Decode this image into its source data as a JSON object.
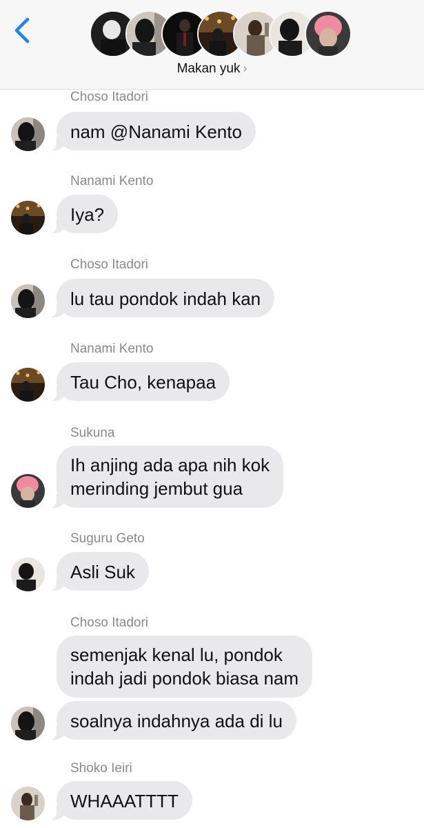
{
  "header": {
    "group_name": "Makan yuk",
    "chevron": "›",
    "back_icon": "chevron-left-icon",
    "accent_color": "#1a82fb"
  },
  "messages": [
    {
      "sender": "Choso Itadori",
      "lines": [
        "nam @Nanami Kento"
      ]
    },
    {
      "sender": "Nanami Kento",
      "lines": [
        "Iya?"
      ]
    },
    {
      "sender": "Choso Itadori",
      "lines": [
        "lu tau pondok indah kan"
      ]
    },
    {
      "sender": "Nanami Kento",
      "lines": [
        "Tau Cho, kenapaa"
      ]
    },
    {
      "sender": "Sukuna",
      "lines": [
        "Ih anjing ada apa nih kok",
        "merinding jembut gua"
      ]
    },
    {
      "sender": "Suguru Geto",
      "lines": [
        "Asli Suk"
      ]
    },
    {
      "sender": "Choso Itadori",
      "lines": [
        "semenjak kenal lu, pondok",
        "indah jadi pondok biasa nam"
      ]
    },
    {
      "sender": "",
      "lines": [
        "soalnya indahnya ada di lu"
      ]
    },
    {
      "sender": "Shoko Ieiri",
      "lines": [
        "WHAAATTTT"
      ]
    }
  ]
}
